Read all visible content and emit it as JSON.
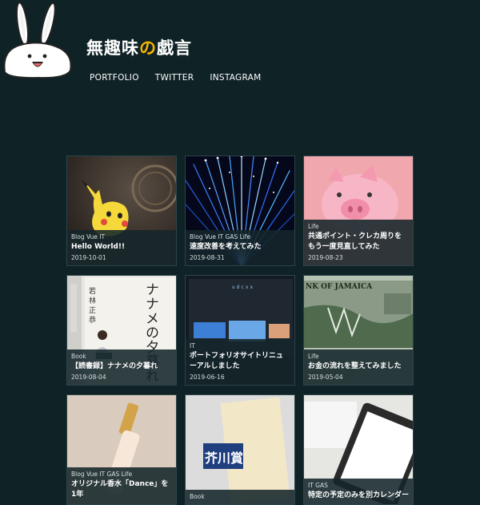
{
  "header": {
    "title_part1": "無趣味",
    "title_accent": "の",
    "title_part2": "戯言",
    "nav": [
      {
        "label": "PORTFOLIO"
      },
      {
        "label": "TWITTER"
      },
      {
        "label": "INSTAGRAM"
      }
    ]
  },
  "posts": [
    {
      "tags": "Blog Vue IT",
      "title": "Hello World!!",
      "date": "2019-10-01"
    },
    {
      "tags": "Blog Vue IT GAS Life",
      "title": "速度改善を考えてみた",
      "date": "2019-08-31"
    },
    {
      "tags": "Life",
      "title": "共通ポイント・クレカ周りをもう一度見直してみた",
      "date": "2019-08-23"
    },
    {
      "tags": "Book",
      "title": "【読書録】ナナメの夕暮れ",
      "date": "2019-08-04"
    },
    {
      "tags": "IT",
      "title": "ポートフォリオサイトリニューアルしました",
      "date": "2019-06-16"
    },
    {
      "tags": "Life",
      "title": "お金の流れを整えてみました",
      "date": "2019-05-04"
    },
    {
      "tags": "Blog Vue IT GAS Life",
      "title": "オリジナル香水「Dance」を1年",
      "date": ""
    },
    {
      "tags": "Book",
      "title": "",
      "date": ""
    },
    {
      "tags": "IT GAS",
      "title": "特定の予定のみを別カレンダー",
      "date": ""
    }
  ],
  "book_cover": {
    "author": "若林正恭",
    "title": "ナナメの夕暮れ"
  },
  "screen_text": "udcxx",
  "banknote_text": "NK OF JAMAICA",
  "magazine_text": "芥川賞"
}
